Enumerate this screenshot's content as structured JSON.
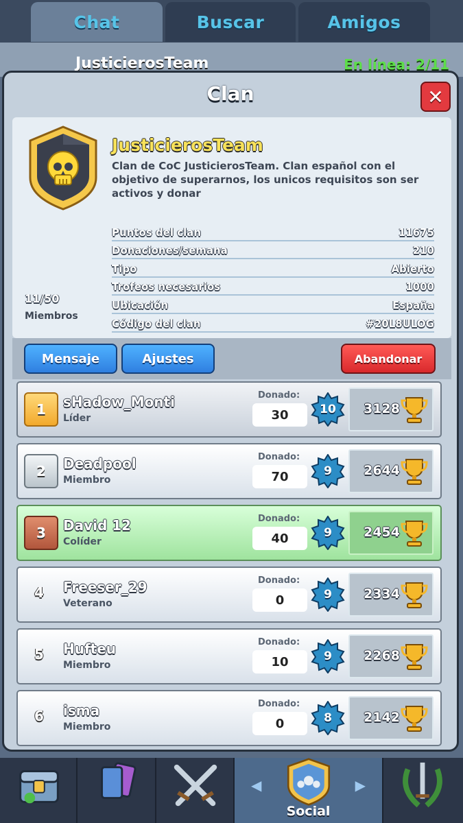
{
  "tabs": [
    {
      "label": "Chat",
      "active": true
    },
    {
      "label": "Buscar",
      "active": false
    },
    {
      "label": "Amigos",
      "active": false
    }
  ],
  "behind": {
    "clan_name": "JusticierosTeam",
    "online": "En línea: 2/11"
  },
  "modal": {
    "title": "Clan",
    "close_icon": "close-icon"
  },
  "clan": {
    "name": "JusticierosTeam",
    "description": "Clan de CoC JusticierosTeam. Clan español con el objetivo de superarnos, los unicos requisitos son ser activos y donar",
    "stats": [
      {
        "label": "Puntos del clan",
        "value": "11675"
      },
      {
        "label": "Donaciones/semana",
        "value": "210"
      },
      {
        "label": "Tipo",
        "value": "Abierto"
      },
      {
        "label": "Trofeos necesarios",
        "value": "1000"
      },
      {
        "label": "Ubicación",
        "value": "España"
      },
      {
        "label": "Código del clan",
        "value": "#20L8ULOG"
      }
    ],
    "members_count": "11/50",
    "members_label": "Miembros"
  },
  "actions": {
    "message": "Mensaje",
    "settings": "Ajustes",
    "leave": "Abandonar"
  },
  "donated_label": "Donado:",
  "members": [
    {
      "rank": "1",
      "name": "sHadow_Monti",
      "role": "Líder",
      "donated": "30",
      "level": "10",
      "trophies": "3128"
    },
    {
      "rank": "2",
      "name": "Deadpool",
      "role": "Miembro",
      "donated": "70",
      "level": "9",
      "trophies": "2644"
    },
    {
      "rank": "3",
      "name": "David 12",
      "role": "Colíder",
      "donated": "40",
      "level": "9",
      "trophies": "2454"
    },
    {
      "rank": "4",
      "name": "Freeser_29",
      "role": "Veterano",
      "donated": "0",
      "level": "9",
      "trophies": "2334"
    },
    {
      "rank": "5",
      "name": "Hufteu",
      "role": "Miembro",
      "donated": "10",
      "level": "9",
      "trophies": "2268"
    },
    {
      "rank": "6",
      "name": "isma",
      "role": "Miembro",
      "donated": "0",
      "level": "8",
      "trophies": "2142"
    }
  ],
  "bottom_nav": {
    "active_label": "Social"
  },
  "colors": {
    "accent": "#57c4e8",
    "clan_name": "#f8e25a",
    "leave": "#e33a3f",
    "button": "#2f7fe0"
  }
}
